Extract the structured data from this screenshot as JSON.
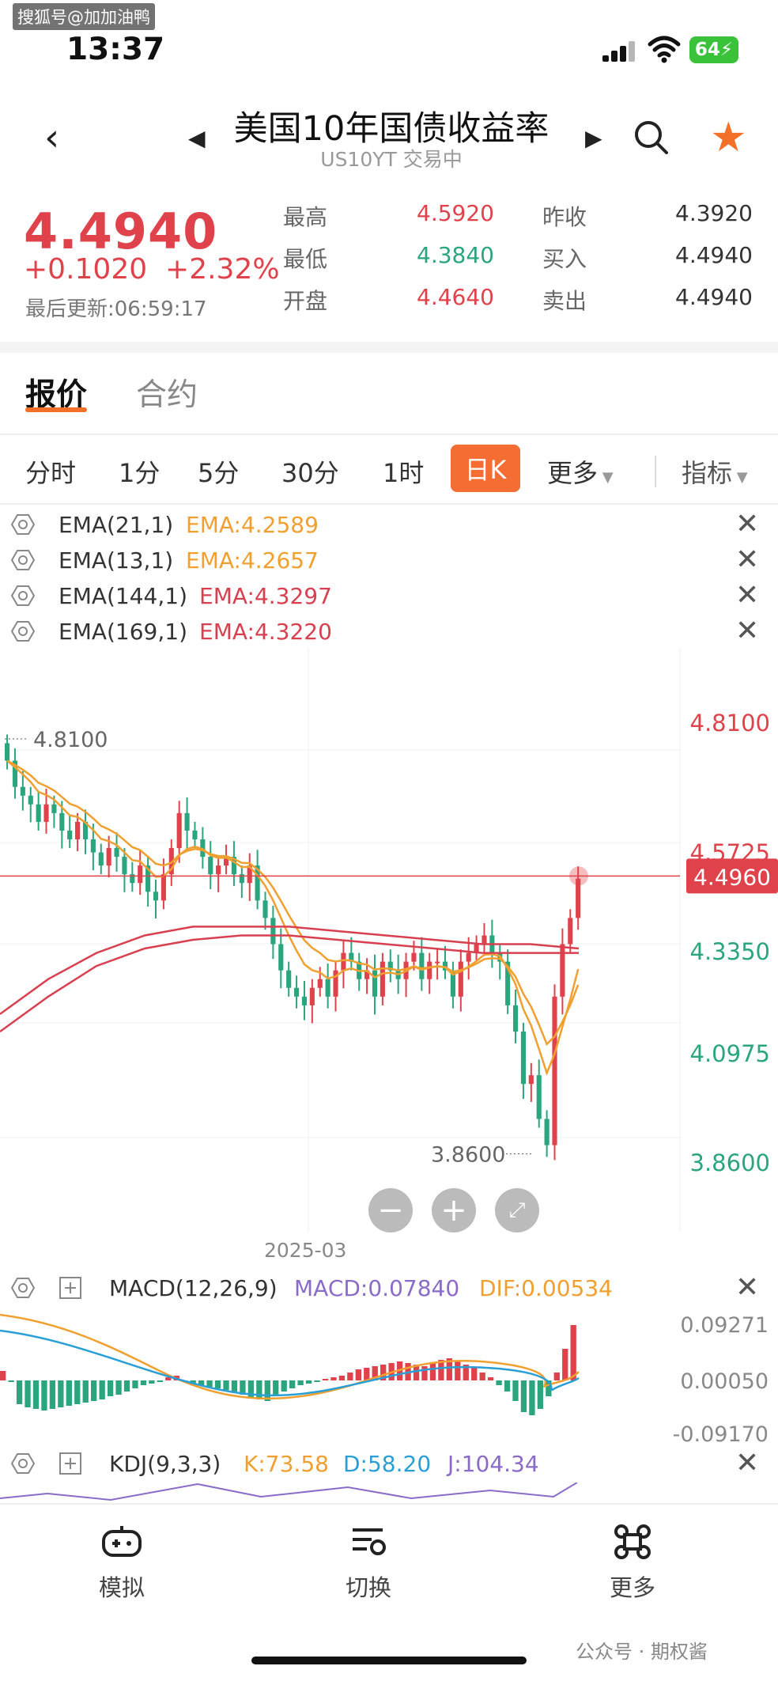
{
  "watermark_top": "搜狐号@加加油鸭",
  "status_bar": {
    "time": "13:37",
    "battery": "64"
  },
  "header": {
    "title": "美国10年国债收益率",
    "subtitle": "US10YT 交易中"
  },
  "quote": {
    "price": "4.4940",
    "change": "+0.1020",
    "change_pct": "+2.32%",
    "updated": "最后更新:06:59:17",
    "stats": {
      "high_label": "最高",
      "high_value": "4.5920",
      "low_label": "最低",
      "low_value": "4.3840",
      "open_label": "开盘",
      "open_value": "4.4640",
      "prev_close_label": "昨收",
      "prev_close_value": "4.3920",
      "bid_label": "买入",
      "bid_value": "4.4940",
      "ask_label": "卖出",
      "ask_value": "4.4940"
    }
  },
  "main_tabs": {
    "quote": "报价",
    "contract": "合约"
  },
  "periods": {
    "p1": "分时",
    "p2": "1分",
    "p3": "5分",
    "p4": "30分",
    "p5": "1时",
    "p6": "日K",
    "more": "更多",
    "indicators": "指标"
  },
  "ema_rows": [
    {
      "name": "EMA(21,1)",
      "value": "EMA:4.2589",
      "color": "#f0a030"
    },
    {
      "name": "EMA(13,1)",
      "value": "EMA:4.2657",
      "color": "#f0a030"
    },
    {
      "name": "EMA(144,1)",
      "value": "EMA:4.3297",
      "color": "#d84050"
    },
    {
      "name": "EMA(169,1)",
      "value": "EMA:4.3220",
      "color": "#d84050"
    }
  ],
  "kline": {
    "high_marker": "4.8100",
    "low_marker": "3.8600",
    "axis": [
      "4.8100",
      "4.5725",
      "4.3350",
      "4.0975",
      "3.8600"
    ],
    "current": "4.4960",
    "date_label": "2025-03"
  },
  "macd": {
    "name": "MACD(12,26,9)",
    "macd": "MACD:0.07840",
    "dif": "DIF:0.00534",
    "axis": [
      "0.09271",
      "0.00050",
      "-0.09170"
    ]
  },
  "kdj": {
    "name": "KDJ(9,3,3)",
    "k": "K:73.58",
    "d": "D:58.20",
    "j": "J:104.34"
  },
  "bottom_nav": {
    "sim": "模拟",
    "switch": "切换",
    "more": "更多"
  },
  "watermark_bottom": "公众号 · 期权酱",
  "colors": {
    "up": "#e0424b",
    "down": "#2aa57e",
    "accent": "#f27028",
    "ema_short": "#f0a030",
    "ema_long": "#d84050"
  }
}
